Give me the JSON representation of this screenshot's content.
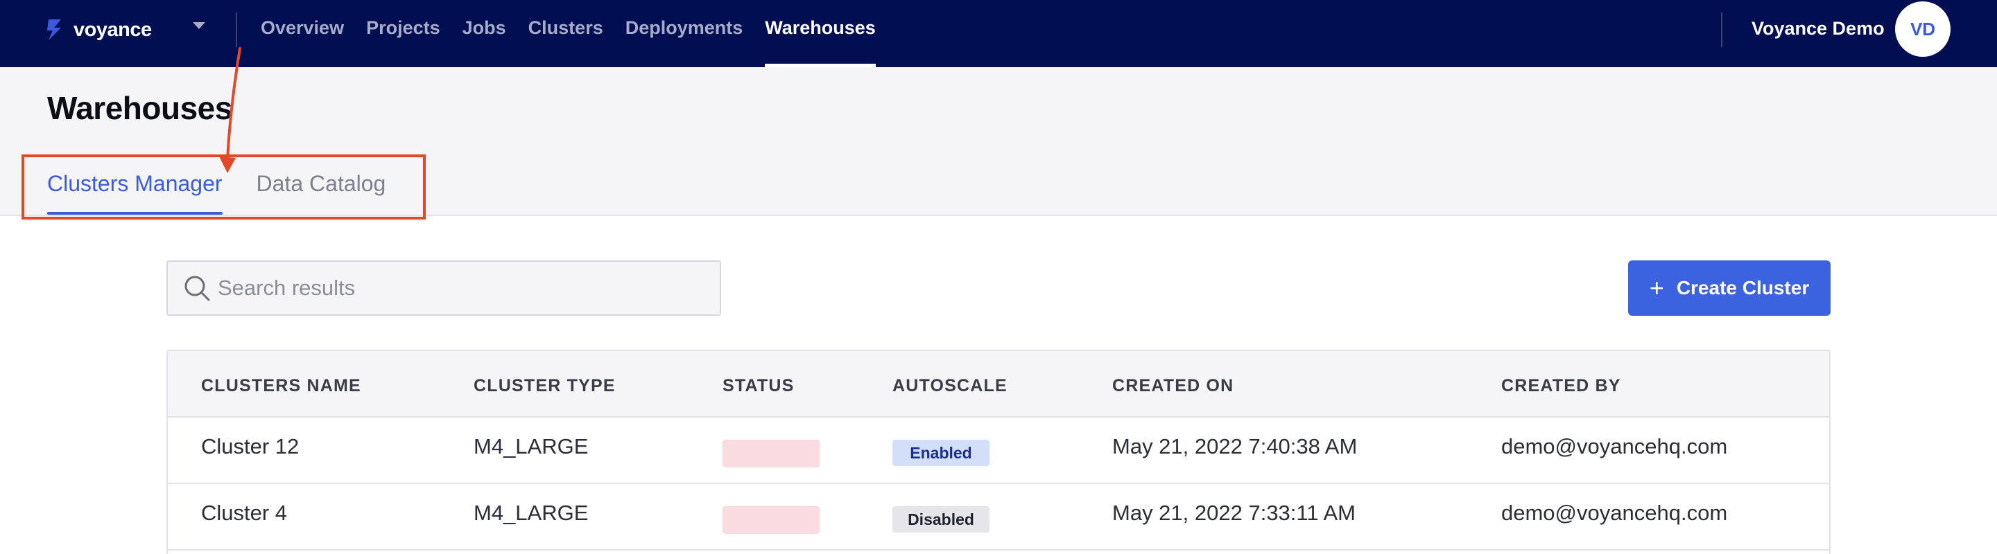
{
  "brand": {
    "name": "voyance",
    "accent": "#3b5bdb",
    "nav_bg": "#020e52"
  },
  "nav": {
    "links": [
      {
        "label": "Overview",
        "active": false
      },
      {
        "label": "Projects",
        "active": false
      },
      {
        "label": "Jobs",
        "active": false
      },
      {
        "label": "Clusters",
        "active": false
      },
      {
        "label": "Deployments",
        "active": false
      },
      {
        "label": "Warehouses",
        "active": true
      }
    ]
  },
  "user": {
    "name": "Voyance Demo",
    "initials": "VD"
  },
  "page": {
    "title": "Warehouses",
    "tabs": [
      {
        "label": "Clusters Manager",
        "active": true
      },
      {
        "label": "Data Catalog",
        "active": false
      }
    ]
  },
  "toolbar": {
    "search_placeholder": "Search results",
    "search_value": "",
    "create_label": "Create Cluster",
    "create_icon": "plus-icon"
  },
  "table": {
    "columns": [
      "CLUSTERS NAME",
      "CLUSTER TYPE",
      "STATUS",
      "AUTOSCALE",
      "CREATED ON",
      "CREATED BY"
    ],
    "rows": [
      {
        "name": "Cluster 12",
        "type": "M4_LARGE",
        "autoscale": "Enabled",
        "created_on": "May 21, 2022 7:40:38 AM",
        "created_by": "demo@voyancehq.com"
      },
      {
        "name": "Cluster 4",
        "type": "M4_LARGE",
        "autoscale": "Disabled",
        "created_on": "May 21, 2022 7:33:11 AM",
        "created_by": "demo@voyancehq.com"
      }
    ]
  },
  "annotation": {
    "color": "#e2492a"
  }
}
